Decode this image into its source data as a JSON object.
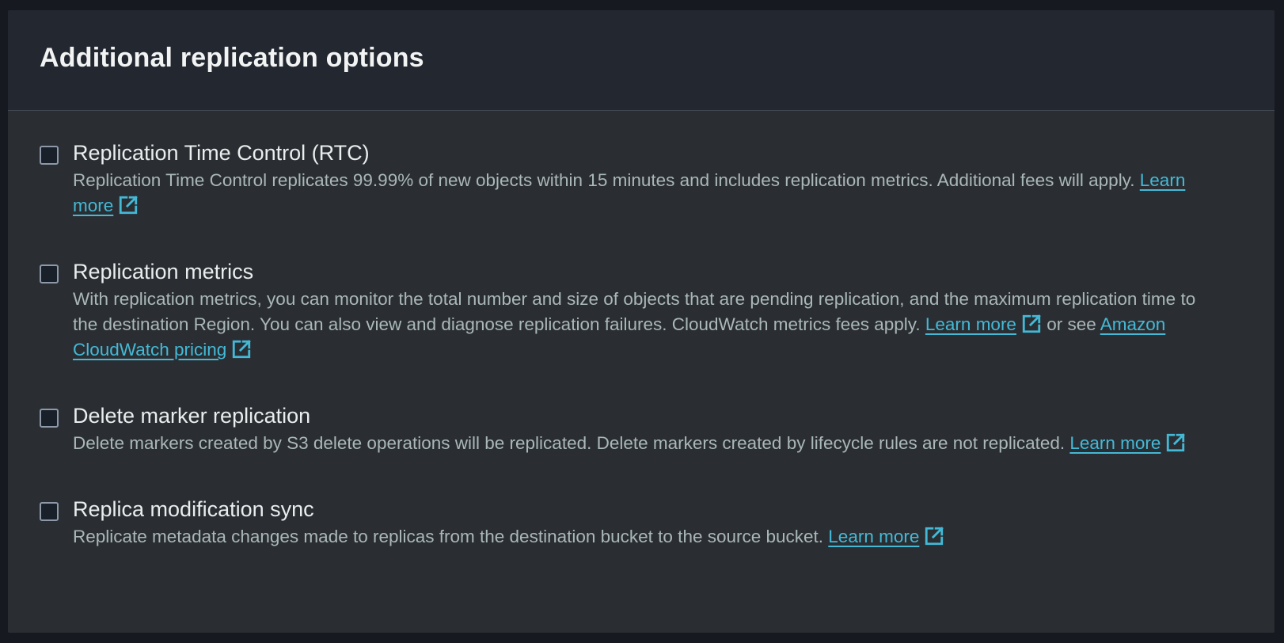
{
  "panel": {
    "title": "Additional replication options"
  },
  "options": [
    {
      "label": "Replication Time Control (RTC)",
      "desc_before": "Replication Time Control replicates 99.99% of new objects within 15 minutes and includes replication metrics. Additional fees will apply. ",
      "link1": "Learn more",
      "checked": false
    },
    {
      "label": "Replication metrics",
      "desc_before": "With replication metrics, you can monitor the total number and size of objects that are pending replication, and the maximum replication time to the destination Region. You can also view and diagnose replication failures. CloudWatch metrics fees apply. ",
      "link1": "Learn more",
      "between": " or see ",
      "link2": "Amazon CloudWatch pricing",
      "checked": false
    },
    {
      "label": "Delete marker replication",
      "desc_before": "Delete markers created by S3 delete operations will be replicated. Delete markers created by lifecycle rules are not replicated. ",
      "link1": "Learn more",
      "checked": false
    },
    {
      "label": "Replica modification sync",
      "desc_before": "Replicate metadata changes made to replicas from the destination bucket to the source bucket. ",
      "link1": "Learn more",
      "checked": false
    }
  ],
  "colors": {
    "link": "#44b9d6",
    "panel_bg": "#2a2e33",
    "header_bg": "#232730"
  },
  "icons": {
    "external_link": "external-link-icon"
  }
}
